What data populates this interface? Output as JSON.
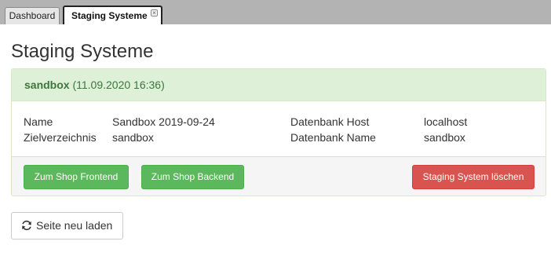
{
  "tabs": [
    {
      "label": "Dashboard",
      "active": false
    },
    {
      "label": "Staging Systeme",
      "active": true,
      "close_icon": "close-icon"
    }
  ],
  "page": {
    "title": "Staging Systeme"
  },
  "system": {
    "name": "sandbox",
    "timestamp": "(11.09.2020 16:36)",
    "fields": {
      "name_label": "Name",
      "name_value": "Sandbox 2019-09-24",
      "dir_label": "Zielverzeichnis",
      "dir_value": "sandbox",
      "db_host_label": "Datenbank Host",
      "db_host_value": "localhost",
      "db_name_label": "Datenbank Name",
      "db_name_value": "sandbox"
    },
    "buttons": {
      "frontend": "Zum Shop Frontend",
      "backend": "Zum Shop Backend",
      "delete": "Staging System löschen"
    }
  },
  "reload": {
    "label": "Seite neu laden",
    "icon": "refresh-icon"
  },
  "colors": {
    "success": "#5cb85c",
    "danger": "#d9534f",
    "panel_heading_bg": "#dff0d8",
    "panel_heading_text": "#3c763d"
  }
}
